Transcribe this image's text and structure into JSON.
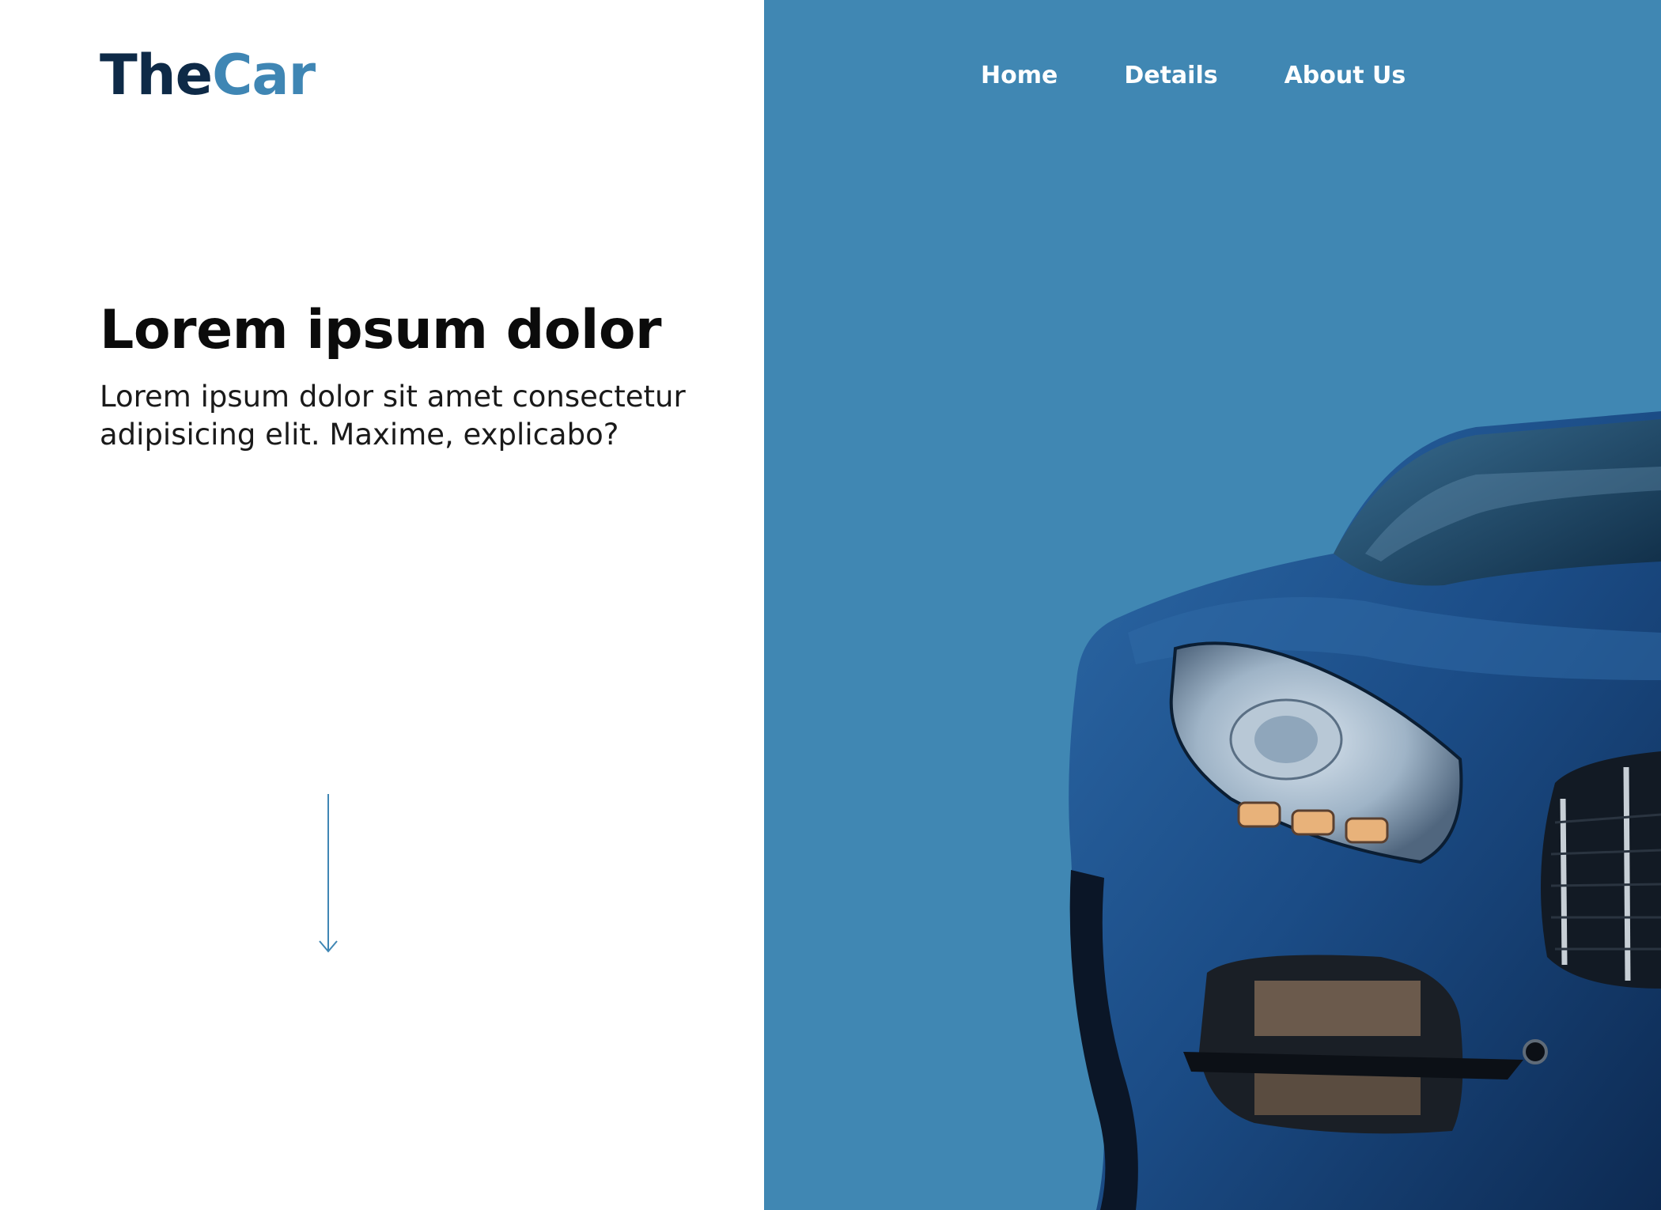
{
  "header": {
    "logo_part1": "The",
    "logo_part2": "Car",
    "nav": [
      "Home",
      "Details",
      "About Us"
    ]
  },
  "hero": {
    "title": "Lorem ipsum dolor",
    "text": "Lorem ipsum dolor sit amet consectetur adipisicing elit. Maxime, explicabo?"
  },
  "icons": {
    "scroll": "arrow-down-icon"
  },
  "colors": {
    "brand_dark": "#0e2a47",
    "brand_accent": "#3f86b4",
    "panel_background": "#4087b3",
    "car_body": "#1d4f8a"
  }
}
